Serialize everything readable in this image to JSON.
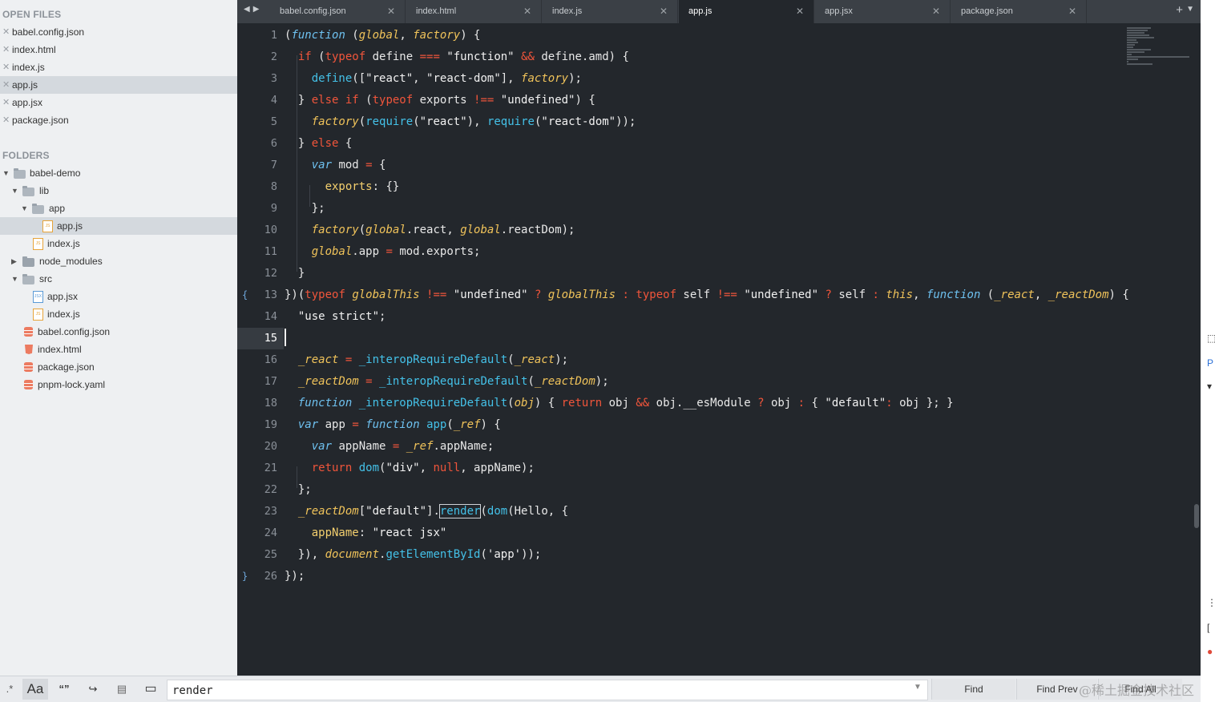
{
  "sidebar": {
    "open_files_heading": "OPEN FILES",
    "open_files": [
      "babel.config.json",
      "index.html",
      "index.js",
      "app.js",
      "app.jsx",
      "package.json"
    ],
    "folders_heading": "FOLDERS",
    "tree": [
      "babel-demo",
      "lib",
      "app",
      "app.js",
      "index.js",
      "node_modules",
      "src",
      "app.jsx",
      "index.js",
      "babel.config.json",
      "index.html",
      "package.json",
      "pnpm-lock.yaml"
    ]
  },
  "tabs": [
    "babel.config.json",
    "index.html",
    "index.js",
    "app.js",
    "app.jsx",
    "package.json"
  ],
  "active_tab": "app.js",
  "editor": {
    "line_numbers": [
      "1",
      "2",
      "3",
      "4",
      "5",
      "6",
      "7",
      "8",
      "9",
      "10",
      "11",
      "12",
      "13",
      "14",
      "15",
      "16",
      "17",
      "18",
      "19",
      "20",
      "21",
      "22",
      "23",
      "24",
      "25",
      "26"
    ],
    "current_line": 15,
    "lines": [
      "(function (global, factory) {",
      "  if (typeof define === \"function\" && define.amd) {",
      "    define([\"react\", \"react-dom\"], factory);",
      "  } else if (typeof exports !== \"undefined\") {",
      "    factory(require(\"react\"), require(\"react-dom\"));",
      "  } else {",
      "    var mod = {",
      "      exports: {}",
      "    };",
      "    factory(global.react, global.reactDom);",
      "    global.app = mod.exports;",
      "  }",
      "})(typeof globalThis !== \"undefined\" ? globalThis : typeof self !== \"undefined\" ? self : this, function (_react, _reactDom) {",
      "  \"use strict\";",
      "",
      "  _react = _interopRequireDefault(_react);",
      "  _reactDom = _interopRequireDefault(_reactDom);",
      "  function _interopRequireDefault(obj) { return obj && obj.__esModule ? obj : { \"default\": obj }; }",
      "  var app = function app(_ref) {",
      "    var appName = _ref.appName;",
      "    return dom(\"div\", null, appName);",
      "  };",
      "  _reactDom[\"default\"].render(dom(Hello, {",
      "    appName: \"react jsx\"",
      "  }), document.getElementById('app'));",
      "});"
    ]
  },
  "findbar": {
    "regex_label": ".*",
    "case_label": "Aa",
    "word_label": "“”",
    "wrap_label": "↪",
    "selection_label": "▤",
    "highlight_label": "▭",
    "query": "render",
    "find_label": "Find",
    "find_prev_label": "Find Prev",
    "find_all_label": "Find All"
  },
  "right_strip": [
    "⬚",
    "P",
    "▾",
    "⋮",
    "[",
    "●"
  ],
  "watermark": "@稀土掘金技术社区",
  "colors": {
    "editor_bg": "#23272c",
    "tabbar_bg": "#3b4046",
    "sidebar_bg": "#eef0f2",
    "keyword_red": "#f0553b",
    "function_cyan": "#44c1e8",
    "italic_yellow": "#f0c35a"
  }
}
